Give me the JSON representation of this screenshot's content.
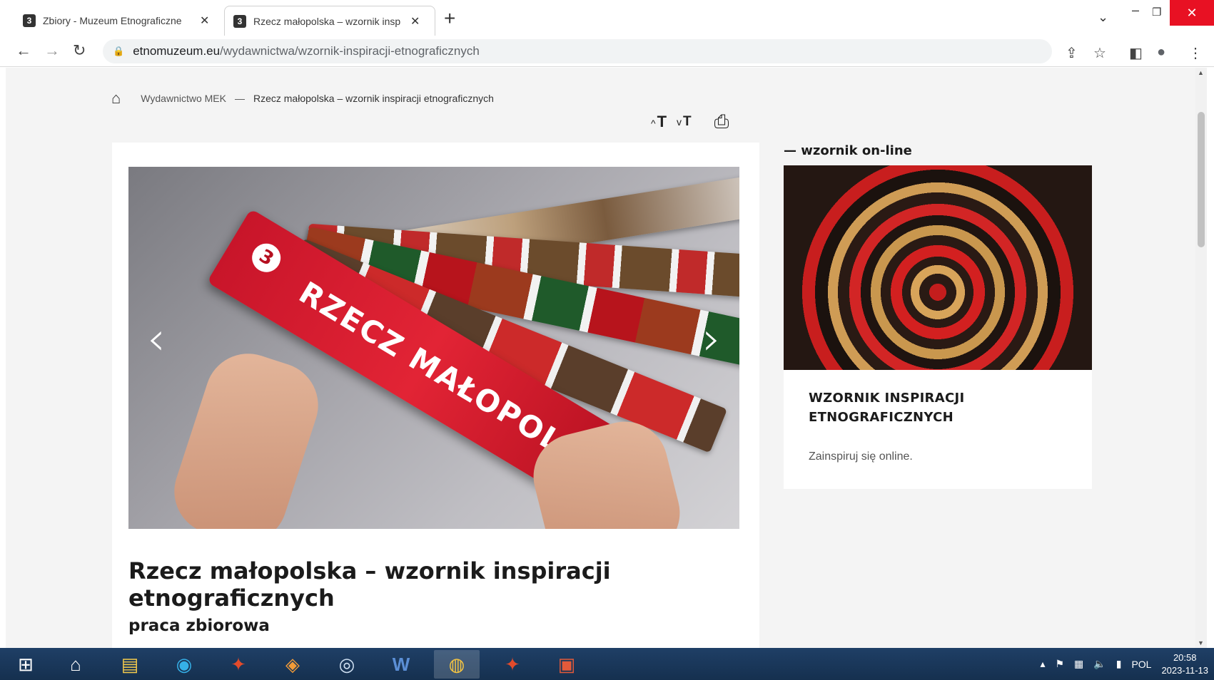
{
  "browser": {
    "tabs": [
      {
        "favicon": "3",
        "title": "Zbiory - Muzeum Etnograficzne",
        "close": "✕",
        "active": false
      },
      {
        "favicon": "3",
        "title": "Rzecz małopolska – wzornik insp",
        "close": "✕",
        "active": true
      }
    ],
    "new_tab": "+",
    "window": {
      "dropdown": "⌄",
      "minimize": "–",
      "restore": "❐",
      "close": "✕"
    },
    "nav": {
      "back": "←",
      "forward": "→",
      "reload": "↻"
    },
    "address": {
      "host": "etnomuzeum.eu",
      "path": "/wydawnictwa/wzornik-inspiracji-etnograficznych"
    },
    "toolbar_icons": {
      "share": "⇪",
      "star": "☆",
      "sidepanel": "◧",
      "profile": "●",
      "menu": "⋮"
    }
  },
  "page": {
    "breadcrumb": {
      "home_icon": "⌂",
      "parent": "Wydawnictwo MEK",
      "separator": "—",
      "current": "Rzecz małopolska – wzornik inspiracji etnograficznych"
    },
    "tools": {
      "increase_symbol": "T",
      "decrease_symbol": "T",
      "up_chevron": "^",
      "down_chevron": "v",
      "print_icon": "⎙"
    },
    "slider": {
      "prev": "‹",
      "next": "›",
      "book_text": "RZECZ MAŁOPOLSKA",
      "logo": "3"
    },
    "title": "Rzecz małopolska – wzornik inspiracji etnograficznych",
    "subtitle": "praca zbiorowa"
  },
  "sidebar": {
    "heading": "— wzornik on-line",
    "card": {
      "title": "WZORNIK INSPIRACJI ETNOGRAFICZNYCH",
      "description": "Zainspiruj się online."
    }
  },
  "taskbar": {
    "apps": [
      {
        "name": "start",
        "glyph": "⊞",
        "active": false
      },
      {
        "name": "home",
        "glyph": "⌂",
        "active": false
      },
      {
        "name": "explorer",
        "glyph": "▤",
        "active": false
      },
      {
        "name": "edge",
        "glyph": "◉",
        "active": false
      },
      {
        "name": "ccleaner",
        "glyph": "✦",
        "active": false
      },
      {
        "name": "app-red",
        "glyph": "◈",
        "active": false
      },
      {
        "name": "media",
        "glyph": "◎",
        "active": false
      },
      {
        "name": "word",
        "glyph": "W",
        "active": false
      },
      {
        "name": "chrome",
        "glyph": "◍",
        "active": true
      },
      {
        "name": "ccleaner-2",
        "glyph": "✦",
        "active": false
      },
      {
        "name": "presentation",
        "glyph": "▣",
        "active": false
      }
    ],
    "tray": {
      "arrow": "▴",
      "flag": "⚑",
      "network": "▦",
      "volume": "🔈",
      "signal": "▮",
      "language": "POL"
    },
    "clock": {
      "time": "20:58",
      "date": "2023-11-13"
    }
  }
}
